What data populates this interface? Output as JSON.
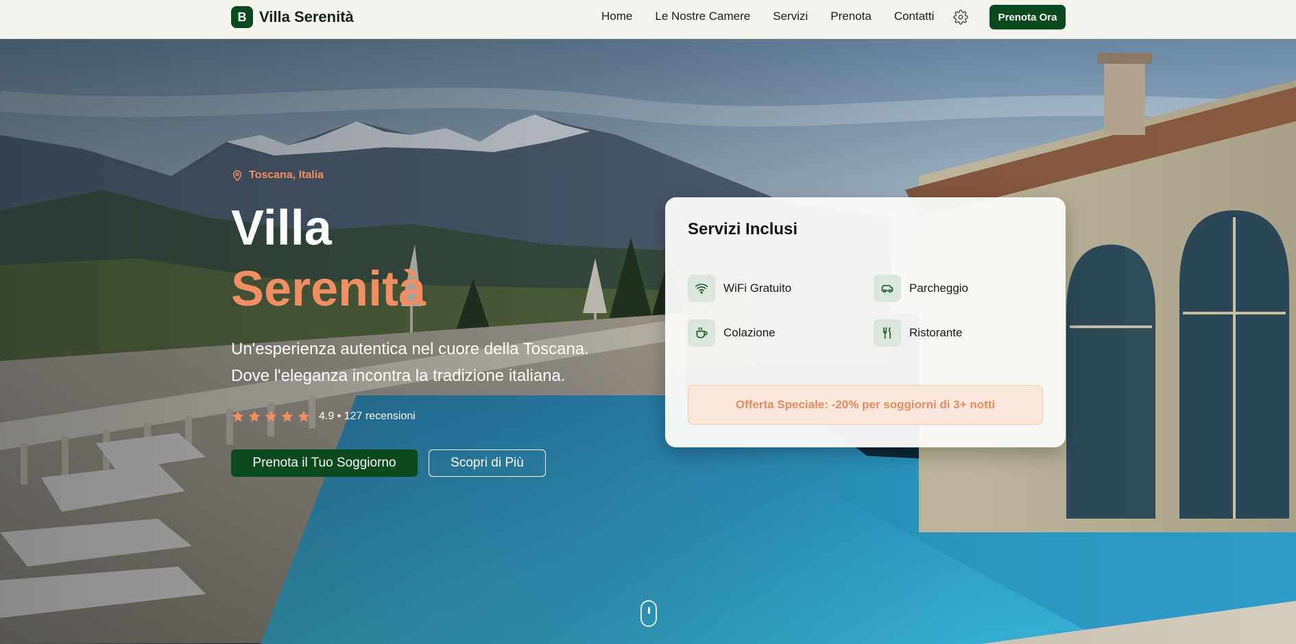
{
  "header": {
    "logo_letter": "B",
    "brand": "Villa Serenità",
    "nav": [
      "Home",
      "Le Nostre Camere",
      "Servizi",
      "Prenota",
      "Contatti"
    ],
    "cta": "Prenota Ora",
    "settings_icon": "gear-icon"
  },
  "hero": {
    "location": "Toscana, Italia",
    "title_line1": "Villa",
    "title_line2": "Serenità",
    "subtitle_line1": "Un'esperienza autentica nel cuore della Toscana.",
    "subtitle_line2": "Dove l'eleganza incontra la tradizione italiana.",
    "rating_stars": 5,
    "rating_text": "4.9 • 127 recensioni",
    "primary_button": "Prenota il Tuo Soggiorno",
    "secondary_button": "Scopri di Più"
  },
  "services": {
    "title": "Servizi Inclusi",
    "items": [
      {
        "label": "WiFi Gratuito",
        "icon": "wifi-icon"
      },
      {
        "label": "Parcheggio",
        "icon": "car-icon"
      },
      {
        "label": "Colazione",
        "icon": "coffee-icon"
      },
      {
        "label": "Ristorante",
        "icon": "utensils-icon"
      }
    ],
    "offer": "Offerta Speciale: -20% per soggiorni di 3+ notti"
  },
  "colors": {
    "brand_green": "#0b4a1e",
    "accent_orange": "#ef8f63",
    "icon_bg": "#dbe6dd",
    "offer_bg": "#fbe8dd"
  }
}
